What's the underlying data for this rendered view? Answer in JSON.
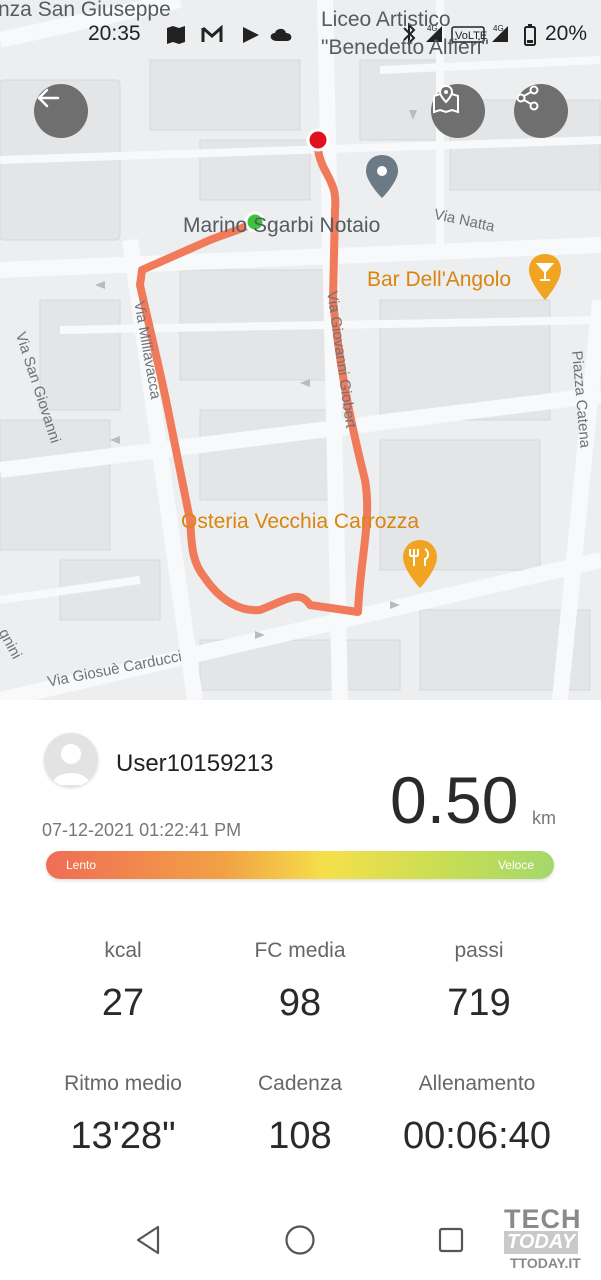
{
  "status_bar": {
    "time": "20:35",
    "battery": "20%",
    "icons": [
      "map-icon",
      "gmail-icon",
      "play-store-icon",
      "cloud-icon",
      "bluetooth-icon",
      "signal-4g-icon",
      "volte-icon",
      "signal-4g-icon",
      "battery-icon"
    ]
  },
  "map": {
    "streets": [
      "nza San Giuseppe",
      "Via Natta",
      "Via Milliavacca",
      "Via Giovanni Giobert",
      "Via San Giovanni",
      "Piazza Catena",
      "Via Giosuè Carducci",
      "gnini"
    ],
    "pois": {
      "liceo_line1": "Liceo Artistico",
      "liceo_line2": "\"Benedetto Alfieri\"",
      "notaio": "Marino Sgarbi Notaio",
      "bar": "Bar Dell'Angolo",
      "osteria": "Osteria Vecchia Carrozza"
    },
    "route_color": "#f07a5a",
    "start_color": "#3cc43c",
    "end_color": "#e0101e"
  },
  "buttons": {
    "back": "back-arrow-icon",
    "map_type": "map-pin-icon",
    "share": "share-icon"
  },
  "summary": {
    "username": "User10159213",
    "datetime": "07-12-2021 01:22:41 PM",
    "distance": "0.50",
    "unit": "km",
    "speed_slow": "Lento",
    "speed_fast": "Veloce"
  },
  "stats": [
    {
      "label": "kcal",
      "value": "27"
    },
    {
      "label": "FC media",
      "value": "98"
    },
    {
      "label": "passi",
      "value": "719"
    },
    {
      "label": "Ritmo medio",
      "value": "13'28\""
    },
    {
      "label": "Cadenza",
      "value": "108"
    },
    {
      "label": "Allenamento",
      "value": "00:06:40"
    }
  ],
  "navbar": {
    "back": "nav-back-icon",
    "home": "nav-home-icon",
    "recents": "nav-recents-icon"
  },
  "watermark": {
    "line1": "TECH",
    "line2": "TODAY",
    "line3": "TTODAY.IT"
  }
}
